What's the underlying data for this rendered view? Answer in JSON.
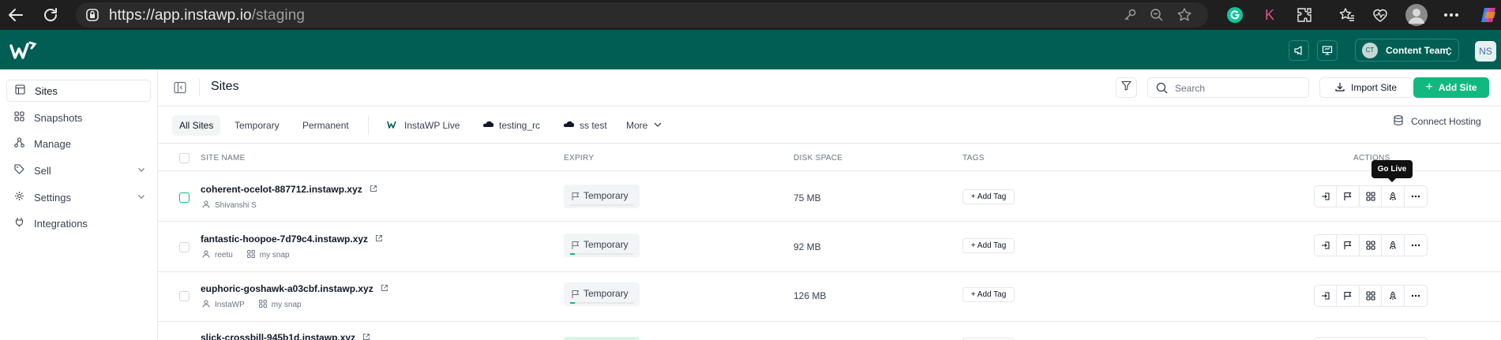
{
  "browser": {
    "url_host": "https://app.instawp.io",
    "url_path": "/staging",
    "ext_k": "K"
  },
  "header": {
    "team_avatar": "CT",
    "team_label": "Content Team",
    "user_initials": "NS"
  },
  "sidebar": {
    "items": [
      {
        "label": "Sites",
        "icon": "layout-icon"
      },
      {
        "label": "Snapshots",
        "icon": "grid-icon"
      },
      {
        "label": "Manage",
        "icon": "sitemap-icon"
      },
      {
        "label": "Sell",
        "icon": "tag-icon"
      },
      {
        "label": "Settings",
        "icon": "gear-icon"
      },
      {
        "label": "Integrations",
        "icon": "plug-icon"
      }
    ]
  },
  "toolbar": {
    "title": "Sites",
    "search_placeholder": "Search",
    "import_label": "Import Site",
    "add_label": "Add Site"
  },
  "tabs": {
    "all": "All Sites",
    "temporary": "Temporary",
    "permanent": "Permanent",
    "instawp_live": "InstaWP Live",
    "testing_rc": "testing_rc",
    "ss_test": "ss test",
    "more": "More",
    "connect_hosting": "Connect Hosting"
  },
  "table": {
    "headers": {
      "site_name": "SITE NAME",
      "expiry": "EXPIRY",
      "disk_space": "DISK SPACE",
      "tags": "TAGS",
      "actions": "ACTIONS"
    },
    "add_tag_label": "+ Add Tag",
    "tooltip": "Go Live",
    "rows": [
      {
        "name": "coherent-ocelot-887712.instawp.xyz",
        "user": "Shivanshi S",
        "snap": "",
        "expiry": "Temporary",
        "expiry_progress": 0.0,
        "disk": "75 MB"
      },
      {
        "name": "fantastic-hoopoe-7d79c4.instawp.xyz",
        "user": "reetu",
        "snap": "my snap",
        "expiry": "Temporary",
        "expiry_progress": 0.08,
        "disk": "92 MB"
      },
      {
        "name": "euphoric-goshawk-a03cbf.instawp.xyz",
        "user": "InstaWP",
        "snap": "my snap",
        "expiry": "Temporary",
        "expiry_progress": 0.08,
        "disk": "126 MB"
      },
      {
        "name": "slick-crossbill-945b1d.instawp.xyz"
      }
    ]
  },
  "colors": {
    "brand_header": "#005e54",
    "accent_green": "#11b981"
  }
}
